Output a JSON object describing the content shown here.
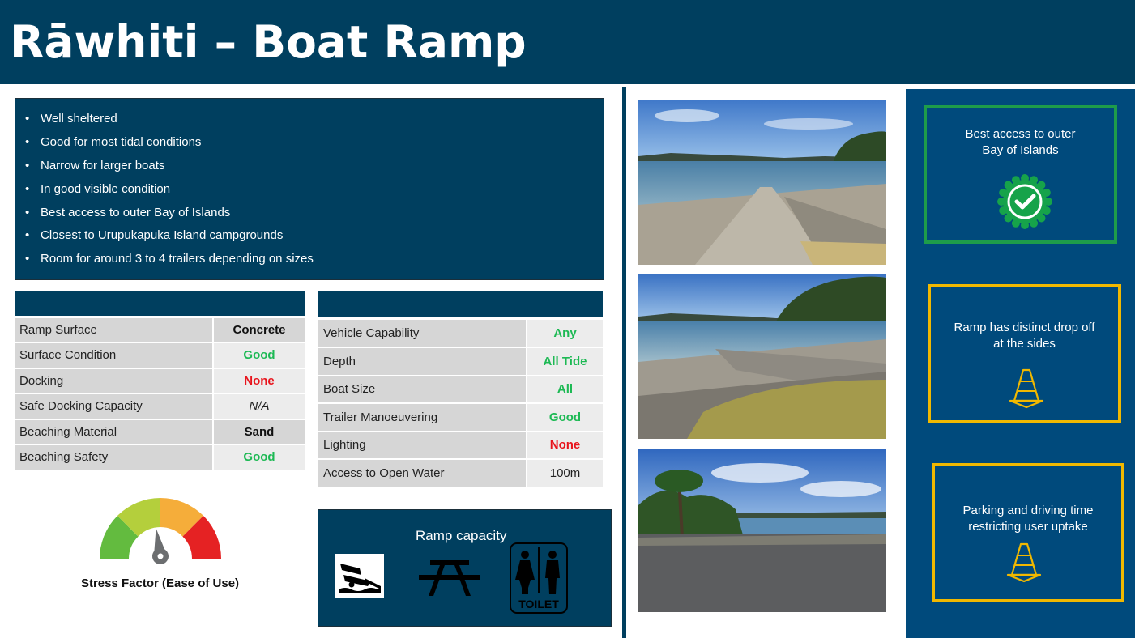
{
  "title": "Rāwhiti – Boat Ramp",
  "features": [
    "Well sheltered",
    "Good for most tidal conditions",
    "Narrow for larger boats",
    "In good visible condition",
    "Best access to outer Bay of Islands",
    "Closest to Urupukapuka Island campgrounds",
    "Room for around 3 to 4 trailers depending on sizes"
  ],
  "ramp_table": [
    {
      "label": "Ramp Surface",
      "value": "Concrete"
    },
    {
      "label": "Surface Condition",
      "value": "Good"
    },
    {
      "label": "Docking",
      "value": "None"
    },
    {
      "label": "Safe Docking Capacity",
      "value": "N/A"
    },
    {
      "label": "Beaching Material",
      "value": "Sand"
    },
    {
      "label": "Beaching Safety",
      "value": "Good"
    }
  ],
  "access_table": [
    {
      "label": "Vehicle Capability",
      "value": "Any"
    },
    {
      "label": "Depth",
      "value": "All Tide"
    },
    {
      "label": "Boat Size",
      "value": "All"
    },
    {
      "label": "Trailer Manoeuvering",
      "value": "Good"
    },
    {
      "label": "Lighting",
      "value": "None"
    },
    {
      "label": "Access to Open Water",
      "value": "100m"
    }
  ],
  "stress": {
    "label": "Stress Factor (Ease of Use)",
    "level": 0.45
  },
  "capacity": {
    "title": "Ramp capacity",
    "toilet_sign": "TOILET"
  },
  "cards": [
    {
      "text_lines": [
        "Best access to outer",
        "Bay of Islands"
      ],
      "icon": "check-badge-icon",
      "border_color": "#1e9c4a"
    },
    {
      "text_lines": [
        "Ramp has distinct drop off",
        "at the sides"
      ],
      "icon": "traffic-cone-icon",
      "border_color": "#f1b800"
    },
    {
      "text_lines": [
        "Parking and driving time",
        "restricting user uptake"
      ],
      "icon": "traffic-cone-icon",
      "border_color": "#f1b800"
    }
  ],
  "colors": {
    "navy": "#003f5f",
    "panel_blue": "#004a7c",
    "good": "#1db954",
    "bad": "#e8141c",
    "gauge": [
      "#63bb3f",
      "#b4cf3c",
      "#f5ad3a",
      "#e52223"
    ]
  }
}
